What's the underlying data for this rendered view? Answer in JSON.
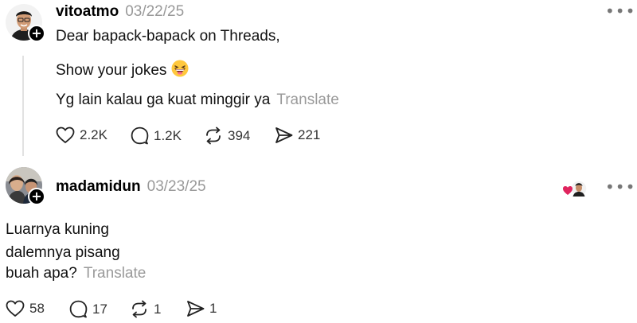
{
  "posts": [
    {
      "username": "vitoatmo",
      "date": "03/22/25",
      "more": "•••",
      "lines": [
        "Dear bapack-bapack on Threads,",
        "Show your jokes",
        "Yg lain kalau ga kuat minggir ya"
      ],
      "emoji": "grinning-squinting-face",
      "translate": "Translate",
      "actions": {
        "likes": "2.2K",
        "replies": "1.2K",
        "reposts": "394",
        "shares": "221"
      }
    },
    {
      "username": "madamidun",
      "date": "03/23/25",
      "more": "•••",
      "lines": [
        "Luarnya kuning",
        "dalemnya pisang",
        "buah apa?"
      ],
      "translate": "Translate",
      "actions": {
        "likes": "58",
        "replies": "17",
        "reposts": "1",
        "shares": "1"
      }
    }
  ],
  "badge_symbol": "+",
  "colors": {
    "heart_red": "#e0245e",
    "muted": "#999999",
    "thread_line": "#e2e2e2"
  }
}
